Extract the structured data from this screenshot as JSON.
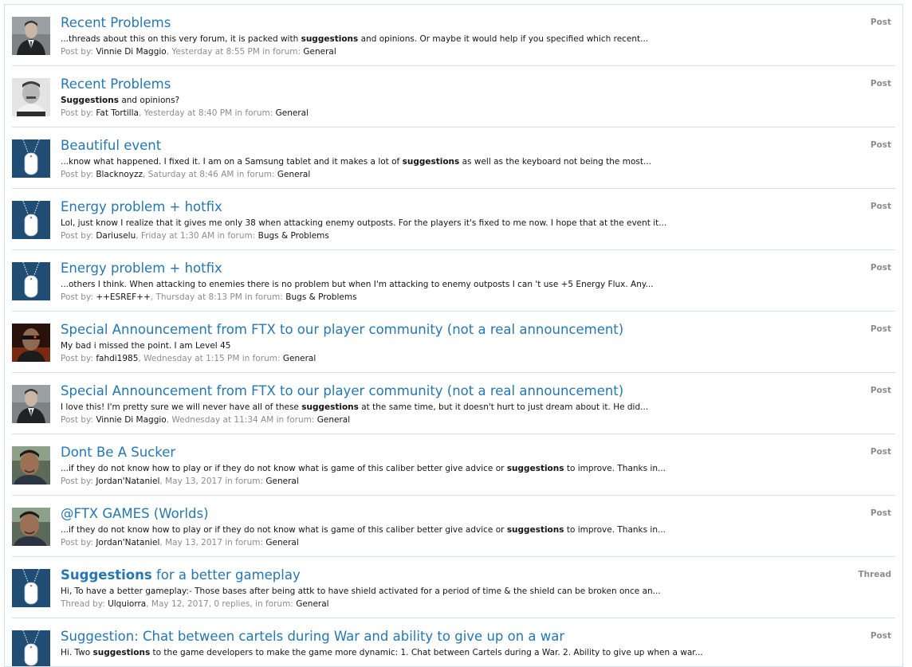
{
  "colors": {
    "link": "#2577b1",
    "muted": "#8c8c8c",
    "text": "#141414",
    "divider": "#d7dfe8",
    "dogtag_bg": "#1f4d73"
  },
  "labels": {
    "post_by": "Post by:",
    "thread_by": "Thread by:",
    "in_forum": "in forum:"
  },
  "results": [
    {
      "type": "Post",
      "avatar": "man-in-suit-photo",
      "title_pre": "Recent Problems",
      "title_hl": "",
      "title_post": "",
      "snippet_pre": "...threads about this on this very forum, it is packed with ",
      "snippet_hl": "suggestions",
      "snippet_post": " and opinions. Or maybe it would help if you specified which recent...",
      "author": "Vinnie Di Maggio",
      "date": "Yesterday at 8:55 PM",
      "extra": "",
      "forum": "General"
    },
    {
      "type": "Post",
      "avatar": "mugshot-photo",
      "title_pre": "Recent Problems",
      "title_hl": "",
      "title_post": "",
      "snippet_pre": "",
      "snippet_hl": "Suggestions",
      "snippet_post": " and opinions?",
      "author": "Fat Tortilla",
      "date": "Yesterday at 8:40 PM",
      "extra": "",
      "forum": "General"
    },
    {
      "type": "Post",
      "avatar": "dog-tag-icon",
      "title_pre": "Beautiful event",
      "title_hl": "",
      "title_post": "",
      "snippet_pre": "...know what happened. I fixed it. I am on a Samsung tablet and it makes a lot of ",
      "snippet_hl": "suggestions",
      "snippet_post": " as well as the keyboard not being the most...",
      "author": "Blacknoyzz",
      "date": "Saturday at 8:46 AM",
      "extra": "",
      "forum": "General"
    },
    {
      "type": "Post",
      "avatar": "dog-tag-icon",
      "title_pre": "Energy problem + hotfix",
      "title_hl": "",
      "title_post": "",
      "snippet_pre": "Lol, just know I realize that it gives me only 38 when attacking enemy outposts. For the players it's fixed to me now. I hope that at the event it...",
      "snippet_hl": "",
      "snippet_post": "",
      "author": "Dariuselu",
      "date": "Friday at 1:30 AM",
      "extra": "",
      "forum": "Bugs & Problems"
    },
    {
      "type": "Post",
      "avatar": "dog-tag-icon",
      "title_pre": "Energy problem + hotfix",
      "title_hl": "",
      "title_post": "",
      "snippet_pre": "...others I think. When attacking to enemies there is no problem but when I'm attacking to enemy outposts I can 't use +5 Energy Flux. Any...",
      "snippet_hl": "",
      "snippet_post": "",
      "author": "++ESREF++",
      "date": "Thursday at 8:13 PM",
      "extra": "",
      "forum": "Bugs & Problems"
    },
    {
      "type": "Post",
      "avatar": "terminator-photo",
      "title_pre": "Special Announcement from FTX to our player community (not a real announcement)",
      "title_hl": "",
      "title_post": "",
      "snippet_pre": "My bad i missed the point. I am Level 45",
      "snippet_hl": "",
      "snippet_post": "",
      "author": "fahdi1985",
      "date": "Wednesday at 1:15 PM",
      "extra": "",
      "forum": "General"
    },
    {
      "type": "Post",
      "avatar": "man-in-suit-photo",
      "title_pre": "Special Announcement from FTX to our player community (not a real announcement)",
      "title_hl": "",
      "title_post": "",
      "snippet_pre": "I love this! I'm pretty sure we will never have all of these ",
      "snippet_hl": "suggestions",
      "snippet_post": " at the same time, but it doesn't hurt to just dream about it. He did...",
      "author": "Vinnie Di Maggio",
      "date": "Wednesday at 11:34 AM",
      "extra": "",
      "forum": "General"
    },
    {
      "type": "Post",
      "avatar": "selfie-photo",
      "title_pre": "Dont Be A Sucker",
      "title_hl": "",
      "title_post": "",
      "snippet_pre": "...if they do not know how to play or if they do not know what is game of this caliber better give advice or ",
      "snippet_hl": "suggestions",
      "snippet_post": " to improve. Thanks in...",
      "author": "Jordan'Nataniel",
      "date": "May 13, 2017",
      "extra": "",
      "forum": "General"
    },
    {
      "type": "Post",
      "avatar": "selfie-photo",
      "title_pre": "@FTX GAMES (Worlds)",
      "title_hl": "",
      "title_post": "",
      "snippet_pre": "...if they do not know how to play or if they do not know what is game of this caliber better give advice or ",
      "snippet_hl": "suggestions",
      "snippet_post": " to improve. Thanks in...",
      "author": "Jordan'Nataniel",
      "date": "May 13, 2017",
      "extra": "",
      "forum": "General"
    },
    {
      "type": "Thread",
      "avatar": "dog-tag-icon",
      "title_pre": "",
      "title_hl": "Suggestions",
      "title_post": " for a better gameplay",
      "snippet_pre": "Hi, To have a better gameplay:- Those bases after being attk to have shield activated for a period of time & the shield can be broken once an...",
      "snippet_hl": "",
      "snippet_post": "",
      "author": "Ulquiorra",
      "date": "May 12, 2017",
      "extra": ", 0 replies,",
      "forum": "General"
    },
    {
      "type": "Post",
      "avatar": "dog-tag-icon",
      "title_pre": "Suggestion: Chat between cartels during War and ability to give up on a war",
      "title_hl": "",
      "title_post": "",
      "snippet_pre": "Hi. Two ",
      "snippet_hl": "suggestions",
      "snippet_post": " to the game developers to make the game more dynamic: 1. Chat between Cartels during a War. 2. Ability to give up when a war...",
      "author": "",
      "date": "",
      "extra": "",
      "forum": ""
    }
  ]
}
